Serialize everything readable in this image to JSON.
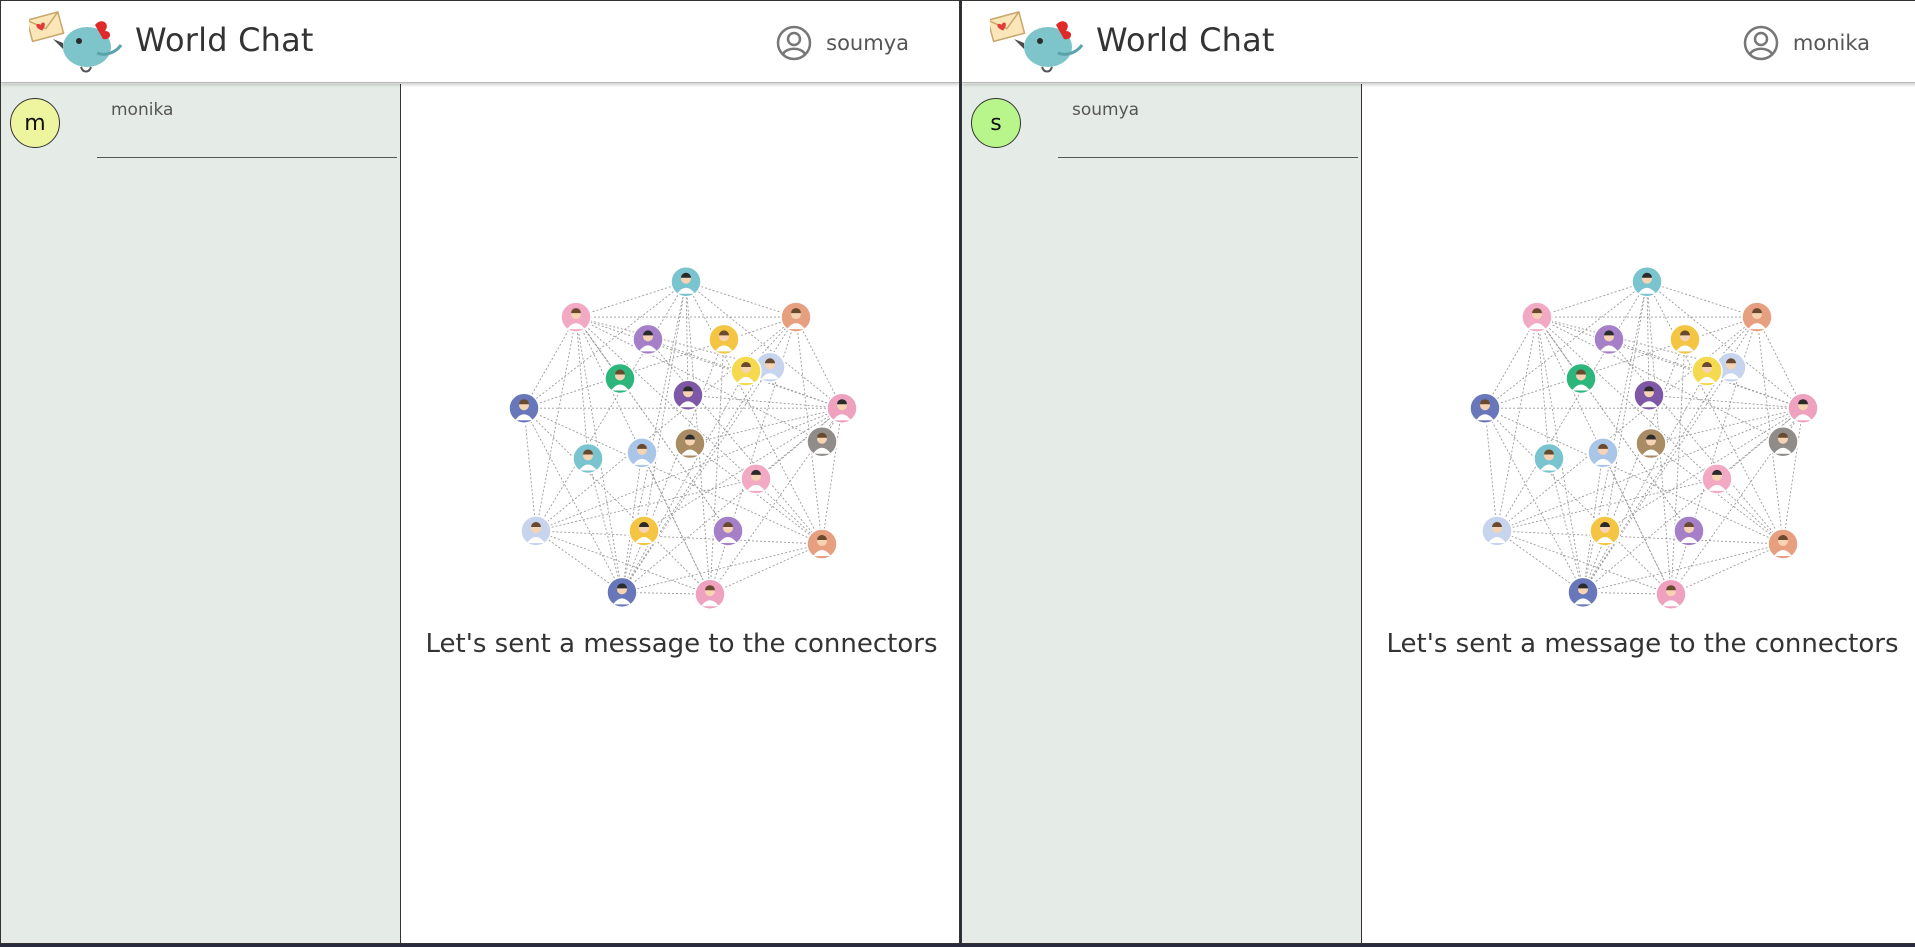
{
  "left_window": {
    "app_title": "World Chat",
    "current_user": "soumya",
    "contacts": [
      {
        "initial": "m",
        "name": "monika",
        "avatar_color": "#edf59e"
      }
    ],
    "empty_state_text": "Let's sent a message to the connectors"
  },
  "right_window": {
    "app_title": "World Chat",
    "current_user": "monika",
    "contacts": [
      {
        "initial": "s",
        "name": "soumya",
        "avatar_color": "#b8f58a"
      }
    ],
    "empty_state_text": "Let's sent a message to the connectors"
  },
  "colors": {
    "sidebar_bg": "#e5ece8",
    "header_bg": "#ffffff",
    "network_node_colors": [
      "#79c4cf",
      "#f2a9c4",
      "#e7a07f",
      "#a57fc7",
      "#f4c542",
      "#c7d4ee",
      "#eea2c0",
      "#6877b9",
      "#2db67c",
      "#7e57a7",
      "#f5d94e",
      "#908c8a",
      "#a98b64",
      "#a9c6e8"
    ]
  },
  "icons": {
    "logo": "bird-with-envelope-logo",
    "user": "user-circle-icon",
    "illustration": "people-network-illustration"
  }
}
